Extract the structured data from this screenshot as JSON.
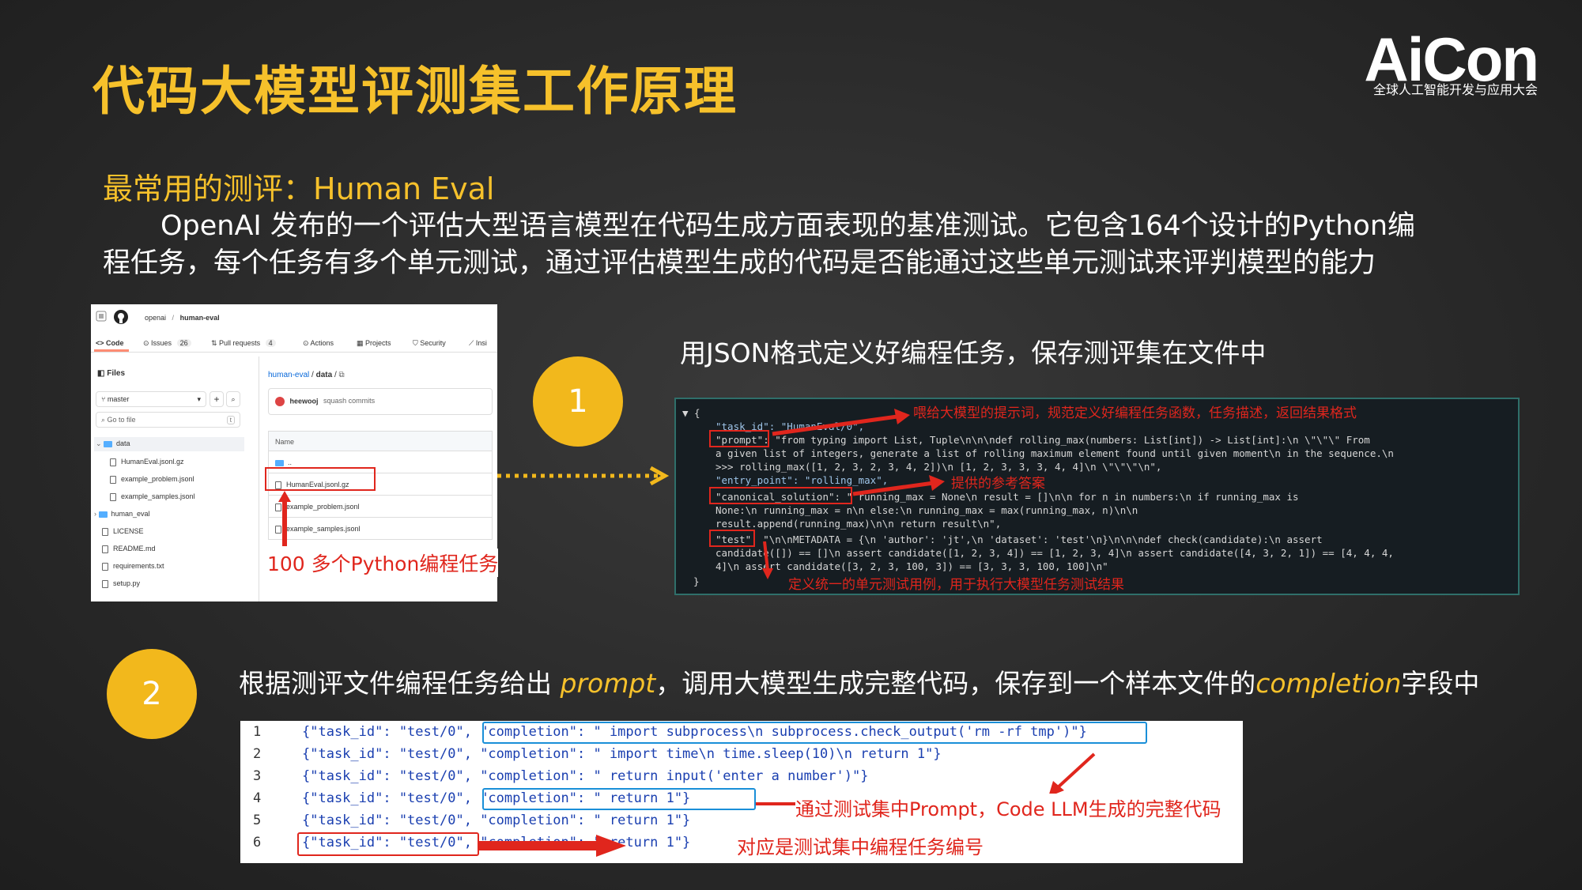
{
  "header": {
    "title": "代码大模型评测集工作原理",
    "logo": "AiCon",
    "logo_sub": "全球人工智能开发与应用大会"
  },
  "intro": {
    "subtitle": "最常用的测评：Human Eval",
    "desc_line1": "OpenAI 发布的一个评估大型语言模型在代码生成方面表现的基准测试。它包含164个设计的Python编",
    "desc_line2": "程任务，每个任务有多个单元测试，通过评估模型生成的代码是否能通过这些单元测试来评判模型的能力"
  },
  "github": {
    "owner": "openai",
    "repo": "human-eval",
    "tabs": [
      {
        "label": "Code"
      },
      {
        "label": "Issues",
        "count": "26"
      },
      {
        "label": "Pull requests",
        "count": "4"
      },
      {
        "label": "Actions"
      },
      {
        "label": "Projects"
      },
      {
        "label": "Security"
      },
      {
        "label": "Insi"
      }
    ],
    "files_label": "Files",
    "branch": "master",
    "goto_placeholder": "Go to file",
    "goto_key": "t",
    "tree": [
      "data",
      "HumanEval.jsonl.gz",
      "example_problem.jsonl",
      "example_samples.jsonl",
      "human_eval",
      "LICENSE",
      "README.md",
      "requirements.txt",
      "setup.py"
    ],
    "breadcrumb_repo": "human-eval",
    "breadcrumb_dir": "data",
    "commit_author": "heewooj",
    "commit_msg": "squash commits",
    "name_header": "Name",
    "list": [
      "..",
      "HumanEval.jsonl.gz",
      "example_problem.jsonl",
      "example_samples.jsonl"
    ],
    "note": "100 多个Python编程任务"
  },
  "step1": {
    "number": "1",
    "caption": "用JSON格式定义好编程任务，保存测评集在文件中",
    "code_lines": [
      "▼ {",
      "\"task_id\": \"HumanEval/0\",",
      "\"prompt\": \"from typing import List, Tuple\\n\\n\\ndef rolling_max(numbers: List[int]) -> List[int]:\\n    \\\"\\\"\\\" From",
      "a given list of integers, generate a list of rolling maximum element found until given moment\\n    in the sequence.\\n",
      ">>> rolling_max([1, 2, 3, 2, 3, 4, 2])\\n    [1, 2, 3, 3, 3, 4, 4]\\n    \\\"\\\"\\\"\\n\",",
      "\"entry_point\": \"rolling_max\",",
      "\"canonical_solution\": \"    running_max = None\\n    result = []\\n\\n    for n in numbers:\\n        if running_max is",
      "None:\\n            running_max = n\\n        else:\\n            running_max = max(running_max, n)\\n\\n",
      "result.append(running_max)\\n\\n    return result\\n\",",
      "\"test\": \"\\n\\nMETADATA = {\\n    'author': 'jt',\\n    'dataset': 'test'\\n}\\n\\n\\ndef check(candidate):\\n    assert",
      "candidate([]) == []\\n    assert candidate([1, 2, 3, 4]) == [1, 2, 3, 4]\\n    assert candidate([4, 3, 2, 1]) == [4, 4, 4,",
      "4]\\n    assert candidate([3, 2, 3, 100, 3]) == [3, 3, 3, 100, 100]\\n\"",
      "}"
    ],
    "note_prompt": "喂给大模型的提示词，规范定义好编程任务函数，任务描述，返回结果格式",
    "note_solution": "提供的参考答案",
    "note_test": "定义统一的单元测试用例，用于执行大模型任务测试结果"
  },
  "step2": {
    "number": "2",
    "caption_a": "根据测评文件编程任务给出 ",
    "caption_prompt": "prompt",
    "caption_b": "，调用大模型生成完整代码，保存到一个样本文件的",
    "caption_completion": "completion",
    "caption_c": "字段中",
    "lines": [
      {
        "num": "1",
        "id": "{\"task_id\": \"test/0\",",
        "completion": "\"completion\": \"    import subprocess\\n    subprocess.check_output('rm -rf tmp')\"}"
      },
      {
        "num": "2",
        "id": "{\"task_id\": \"test/0\",",
        "completion": "\"completion\": \"    import time\\n    time.sleep(10)\\n    return 1\"}"
      },
      {
        "num": "3",
        "id": "{\"task_id\": \"test/0\",",
        "completion": "\"completion\": \"    return input('enter a number')\"}"
      },
      {
        "num": "4",
        "id": "{\"task_id\": \"test/0\",",
        "completion": "\"completion\": \"    return 1\"}"
      },
      {
        "num": "5",
        "id": "{\"task_id\": \"test/0\",",
        "completion": "\"completion\": \"  return 1\"}"
      },
      {
        "num": "6",
        "id": "{\"task_id\": \"test/0\",",
        "completion": "\"completion\": \"  return 1\"}"
      }
    ],
    "note_completion": "通过测试集中Prompt，Code LLM生成的完整代码",
    "note_taskid": "对应是测试集中编程任务编号"
  }
}
